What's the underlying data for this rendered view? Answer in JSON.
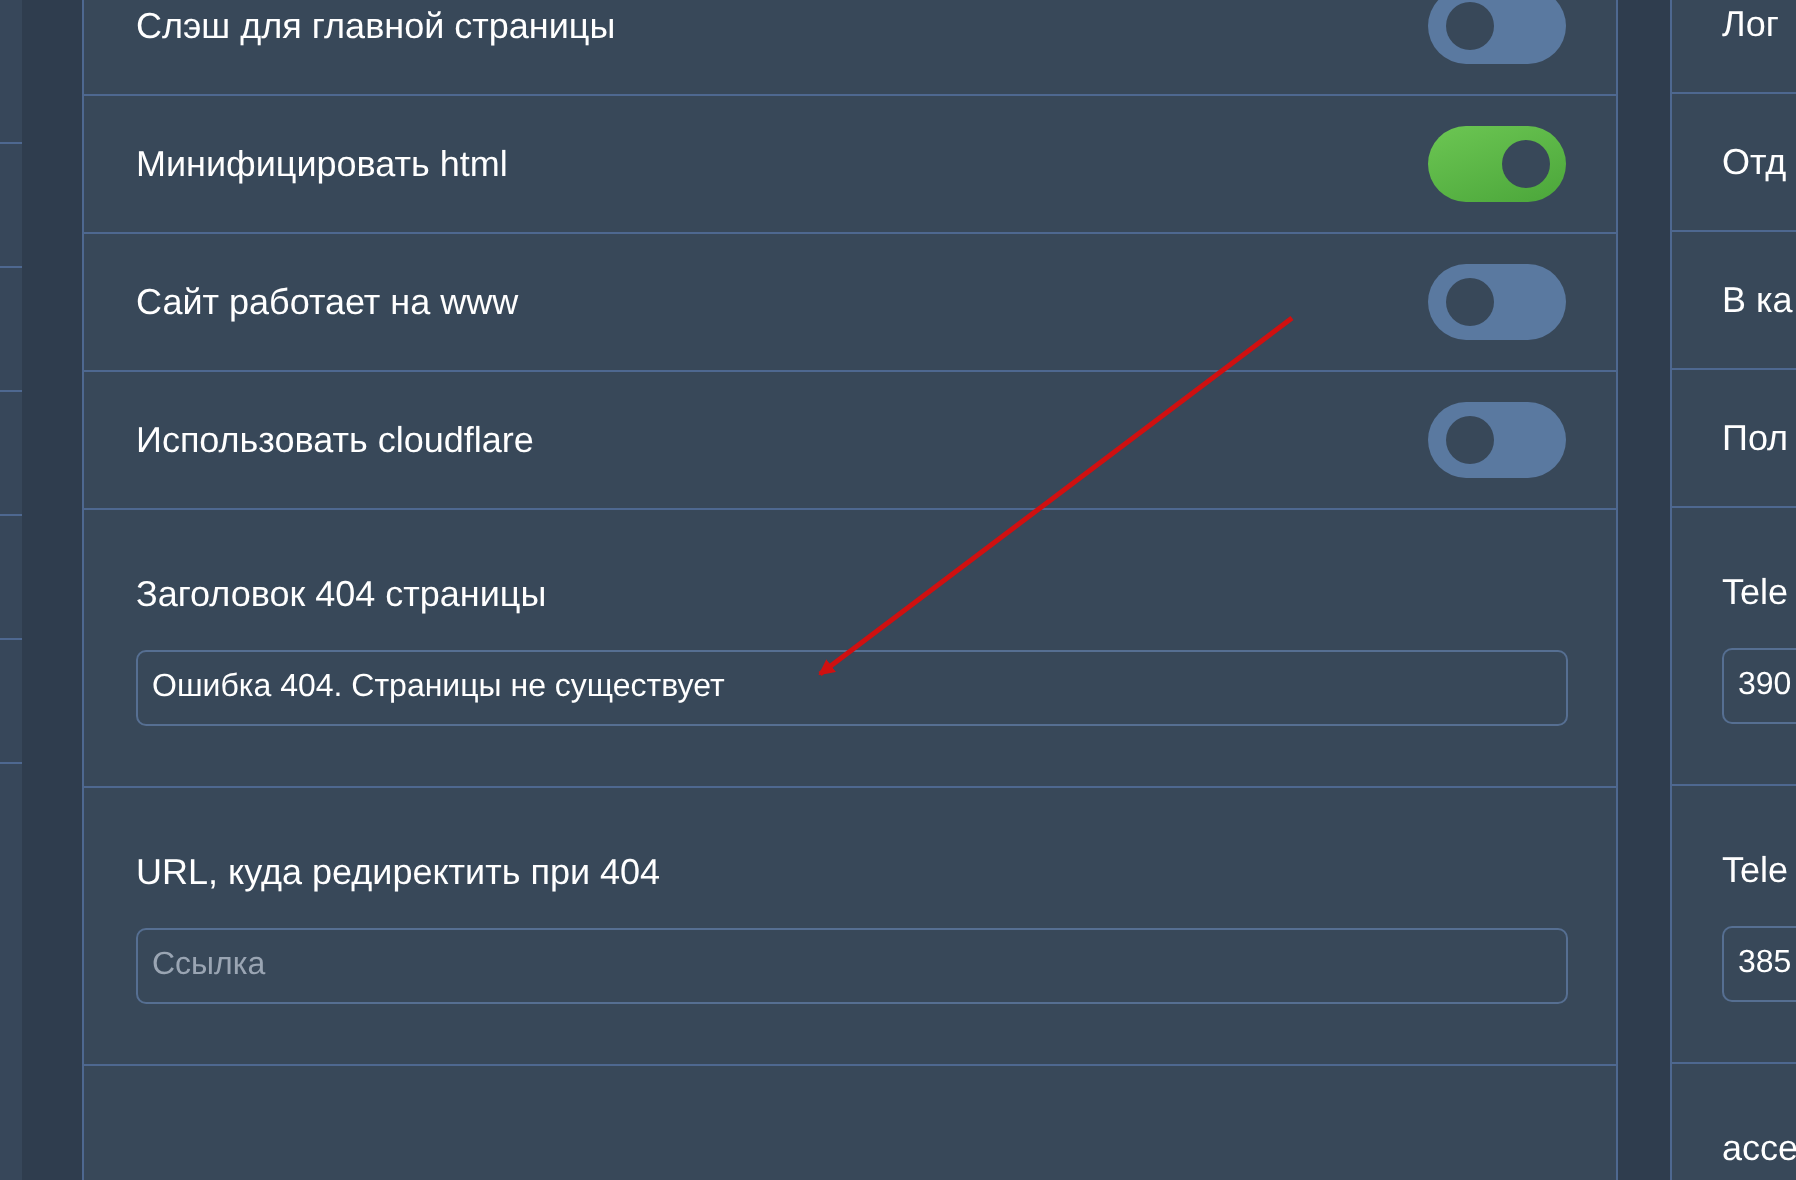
{
  "settings": {
    "toggles": [
      {
        "label": "Слэш для главной страницы",
        "on": false
      },
      {
        "label": "Минифицировать html",
        "on": true
      },
      {
        "label": "Сайт работает на www",
        "on": false
      },
      {
        "label": "Использовать cloudflare",
        "on": false
      }
    ],
    "fields": [
      {
        "label": "Заголовок 404 страницы",
        "value": "Ошибка 404. Страницы не существует"
      },
      {
        "label": "URL, куда редиректить при 404",
        "placeholder": "Ссылка"
      }
    ]
  },
  "right_panel": {
    "rows": [
      {
        "label": "Лог"
      },
      {
        "label": "Отд"
      },
      {
        "label": "В ка"
      },
      {
        "label": "Пол"
      }
    ],
    "fields": [
      {
        "label": "Tele",
        "value": "390"
      },
      {
        "label": "Tele",
        "value": "385"
      },
      {
        "label": "acce"
      }
    ]
  }
}
